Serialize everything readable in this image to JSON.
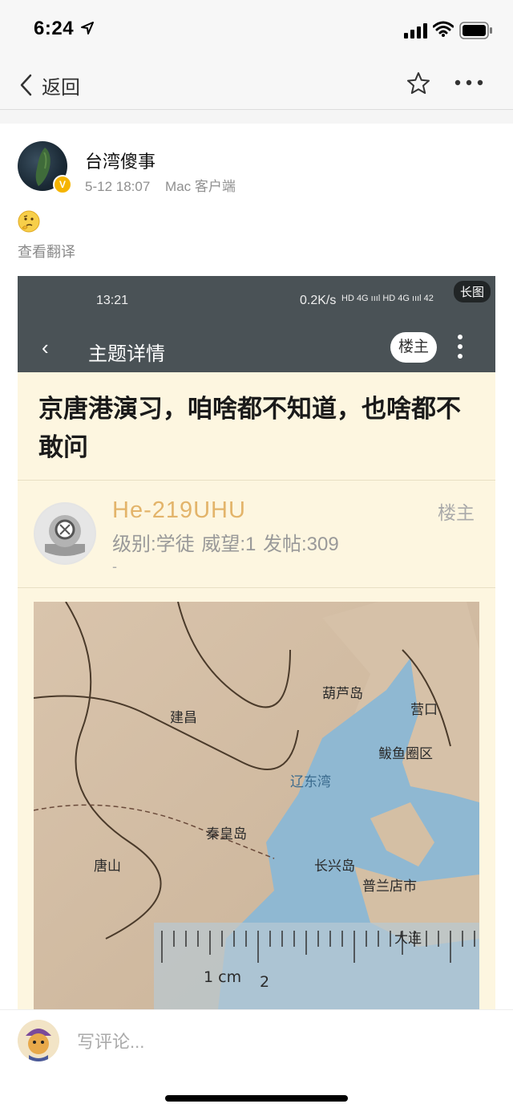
{
  "status_bar": {
    "time": "6:24",
    "icons": [
      "location-arrow-icon",
      "cellular-signal-icon",
      "wifi-icon",
      "battery-icon"
    ]
  },
  "nav": {
    "back_label": "返回",
    "icons": [
      "chevron-left-icon",
      "star-icon",
      "more-icon"
    ]
  },
  "post": {
    "username": "台湾傻事",
    "time": "5-12 18:07",
    "client": "Mac 客户端",
    "translate_label": "查看翻译",
    "emoji": "thinking-face-emoji",
    "verified_badge": "V"
  },
  "embedded": {
    "long_pic_label": "长图",
    "status_time": "13:21",
    "status_rate": "0.2K/s",
    "status_icons": "HD 4G ıııl HD 4G ıııl 42",
    "nav_back": "‹",
    "nav_title": "主题详情",
    "owner_button": "楼主",
    "heading": "京唐港演习，咱啥都不知道，也啥都不敢问",
    "user": {
      "name": "He-219UHU",
      "tag": "楼主",
      "stats": "级别:学徒   威望:1   发帖:309",
      "dash": "-"
    },
    "map_labels": {
      "l1": "葫芦岛",
      "l2": "营口",
      "l3": "秦皇岛",
      "l4": "大连",
      "l5": "唐山",
      "l6": "建昌",
      "l7": "鲅鱼圈区",
      "l8": "长兴岛",
      "l9": "普兰店市",
      "l10": "辽东湾",
      "ruler_label": "1 cm",
      "ruler_digit": "2"
    }
  },
  "comment": {
    "placeholder": "写评论..."
  },
  "colors": {
    "embedded_bar": "#4a5256",
    "embedded_bg": "#fdf6e0",
    "user_name": "#e3b46a",
    "verified": "#f5b400"
  }
}
